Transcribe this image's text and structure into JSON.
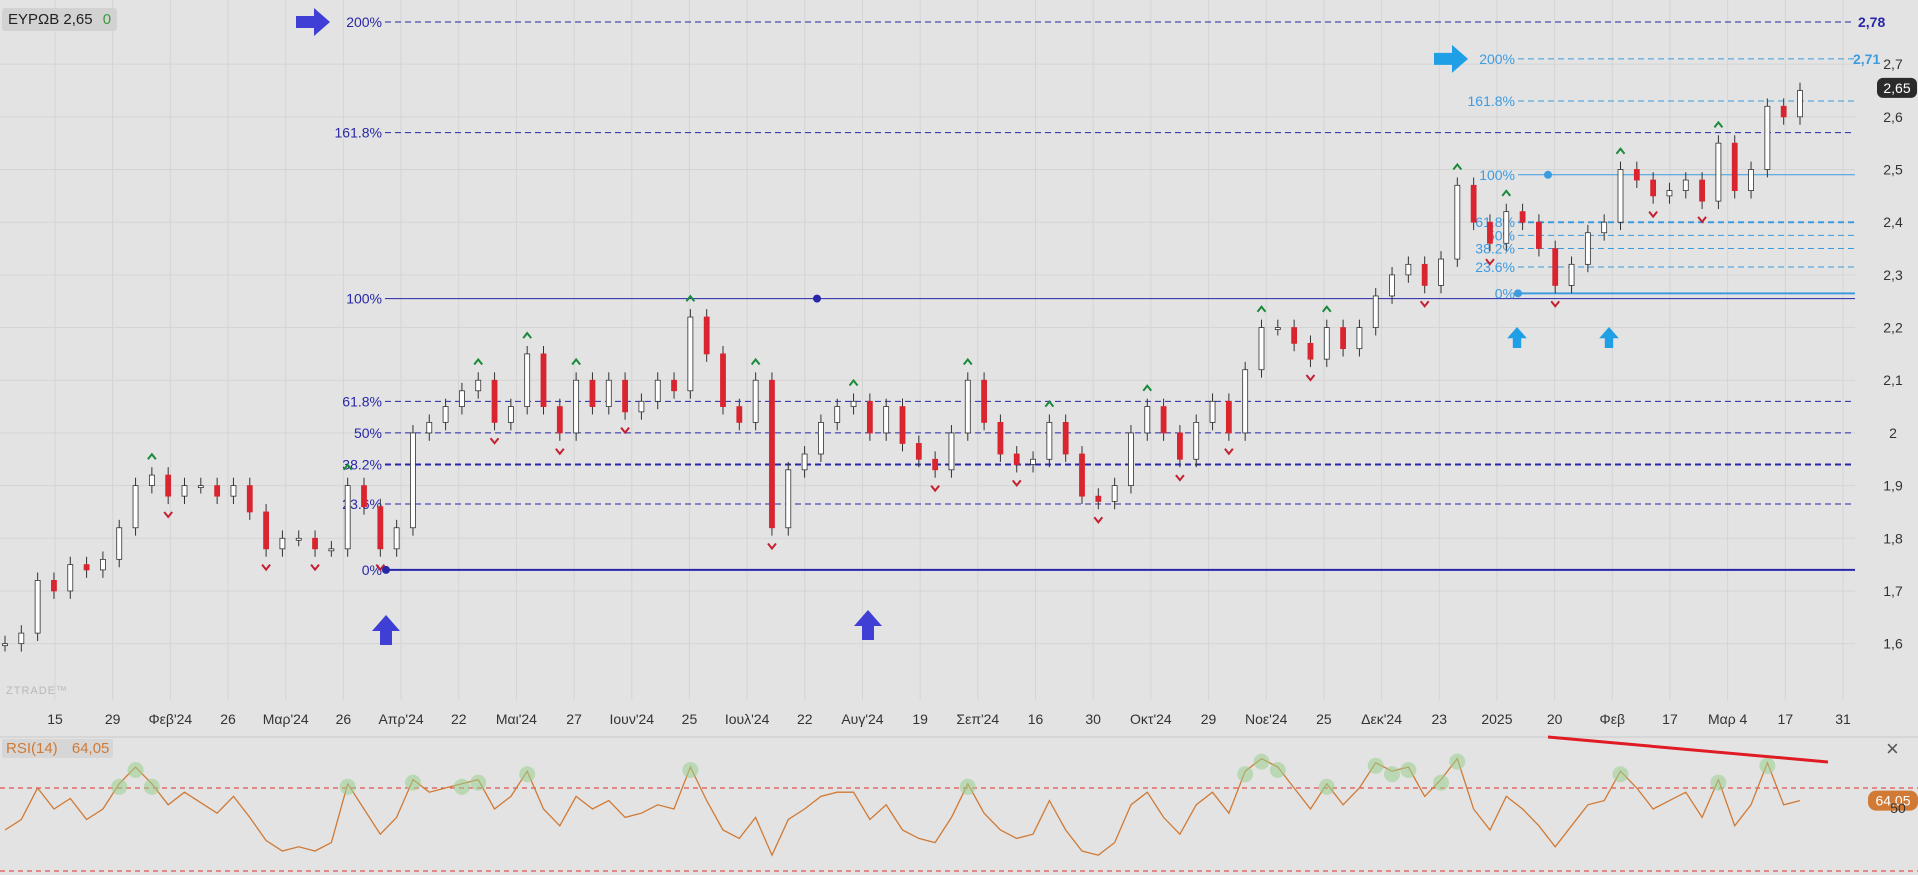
{
  "header": {
    "symbol": "ΕΥΡΩΒ",
    "price": "2,65",
    "change": "0"
  },
  "watermark": "ZTRADE™",
  "rsi": {
    "label": "RSI(14)",
    "value": "64,05",
    "tag": "64,05",
    "level_label": "50",
    "close_glyph": "×"
  },
  "colors": {
    "bg": "#e3e3e3",
    "grid": "#d4d4d4",
    "fibA": "#2727a8",
    "fibB": "#3d9be0",
    "rsi": "#d07a35",
    "up": "#ffffff",
    "down": "#d9252f",
    "arrowA": "#3f3fd6",
    "arrowB": "#1e9fe6",
    "trend": "#e01b24",
    "zone": "#e03030"
  },
  "chart_data": {
    "type": "candlestick",
    "ylim": [
      1.55,
      2.78
    ],
    "y_ticks": [
      "1,6",
      "1,7",
      "1,8",
      "1,9",
      "2",
      "2,1",
      "2,2",
      "2,3",
      "2,4",
      "2,5",
      "2,6",
      "2,7"
    ],
    "x_ticks": [
      "15",
      "29",
      "Φεβ'24",
      "26",
      "Μαρ'24",
      "26",
      "Απρ'24",
      "22",
      "Μαι'24",
      "27",
      "Ιουν'24",
      "25",
      "Ιουλ'24",
      "22",
      "Αυγ'24",
      "19",
      "Σεπ'24",
      "16",
      "30",
      "Οκτ'24",
      "29",
      "Νοε'24",
      "25",
      "Δεκ'24",
      "23",
      "2025",
      "20",
      "Φεβ",
      "17",
      "Μαρ 4",
      "17",
      "31"
    ],
    "last_price_tag": "2,65",
    "fib_left": {
      "levels": [
        {
          "label": "200%",
          "value": 2.78
        },
        {
          "label": "161.8%",
          "value": 2.57
        },
        {
          "label": "100%",
          "value": 2.255
        },
        {
          "label": "61.8%",
          "value": 2.06
        },
        {
          "label": "50%",
          "value": 2.0
        },
        {
          "label": "38.2%",
          "value": 1.94
        },
        {
          "label": "23.6%",
          "value": 1.865
        },
        {
          "label": "0%",
          "value": 1.74
        }
      ],
      "target_label": "2,78"
    },
    "fib_right": {
      "levels": [
        {
          "label": "200%",
          "value": 2.71
        },
        {
          "label": "161.8%",
          "value": 2.63
        },
        {
          "label": "100%",
          "value": 2.49
        },
        {
          "label": "61.8%",
          "value": 2.4
        },
        {
          "label": "50%",
          "value": 2.375
        },
        {
          "label": "38.2%",
          "value": 2.35
        },
        {
          "label": "23.6%",
          "value": 2.315
        },
        {
          "label": "0%",
          "value": 2.265
        }
      ],
      "target_label": "2,71"
    },
    "price_path": [
      1.6,
      1.62,
      1.72,
      1.7,
      1.75,
      1.74,
      1.76,
      1.82,
      1.9,
      1.92,
      1.88,
      1.9,
      1.9,
      1.88,
      1.9,
      1.85,
      1.78,
      1.8,
      1.8,
      1.78,
      1.78,
      1.9,
      1.86,
      1.78,
      1.82,
      2.0,
      2.02,
      2.05,
      2.08,
      2.1,
      2.02,
      2.05,
      2.15,
      2.05,
      2.0,
      2.1,
      2.05,
      2.1,
      2.04,
      2.06,
      2.1,
      2.08,
      2.22,
      2.15,
      2.05,
      2.02,
      2.1,
      1.82,
      1.93,
      1.96,
      2.02,
      2.05,
      2.06,
      2.0,
      2.05,
      1.98,
      1.95,
      1.93,
      2.0,
      2.1,
      2.02,
      1.96,
      1.94,
      1.95,
      2.02,
      1.96,
      1.88,
      1.87,
      1.9,
      2.0,
      2.05,
      2.0,
      1.95,
      2.02,
      2.06,
      2.0,
      2.12,
      2.2,
      2.2,
      2.17,
      2.14,
      2.2,
      2.16,
      2.2,
      2.26,
      2.3,
      2.32,
      2.28,
      2.33,
      2.47,
      2.4,
      2.36,
      2.42,
      2.4,
      2.35,
      2.28,
      2.32,
      2.38,
      2.4,
      2.5,
      2.48,
      2.45,
      2.46,
      2.48,
      2.44,
      2.55,
      2.46,
      2.5,
      2.62,
      2.6,
      2.65
    ],
    "rsi_series": [
      50,
      55,
      70,
      60,
      65,
      55,
      60,
      72,
      80,
      72,
      62,
      68,
      63,
      58,
      66,
      56,
      45,
      40,
      42,
      40,
      44,
      72,
      60,
      48,
      56,
      74,
      68,
      70,
      72,
      74,
      60,
      66,
      78,
      60,
      52,
      66,
      60,
      64,
      56,
      58,
      62,
      60,
      80,
      64,
      50,
      46,
      56,
      38,
      55,
      60,
      66,
      68,
      68,
      55,
      62,
      50,
      46,
      44,
      56,
      72,
      58,
      50,
      46,
      48,
      64,
      50,
      40,
      38,
      44,
      62,
      68,
      56,
      48,
      62,
      68,
      58,
      78,
      84,
      80,
      70,
      60,
      72,
      62,
      70,
      82,
      78,
      80,
      66,
      74,
      84,
      60,
      50,
      66,
      60,
      52,
      42,
      52,
      62,
      64,
      78,
      70,
      60,
      64,
      68,
      56,
      74,
      52,
      62,
      82,
      62,
      64
    ],
    "rsi_range": [
      30,
      90
    ],
    "rsi_upper_zone": 70
  }
}
